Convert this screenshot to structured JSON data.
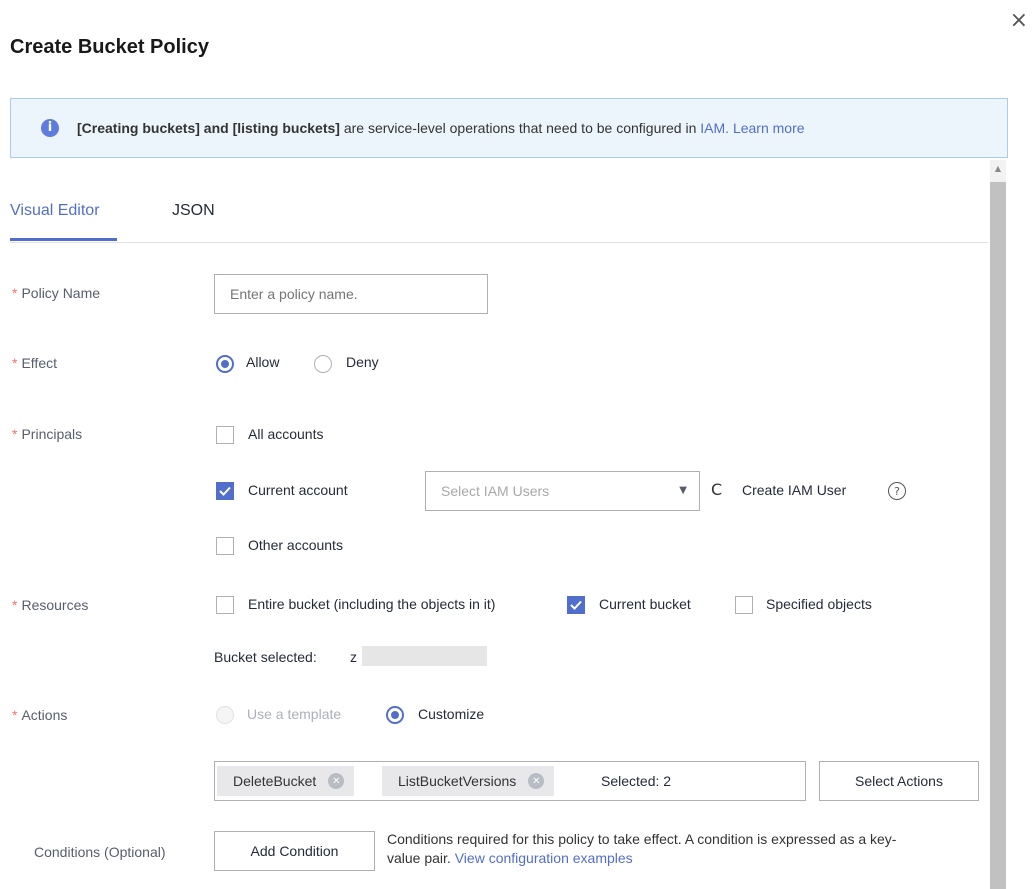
{
  "dialog": {
    "title": "Create Bucket Policy",
    "close_icon": "×"
  },
  "banner": {
    "icon": "i",
    "bold_text": "[Creating buckets] and [listing buckets]",
    "text": " are service-level operations that need to be configured in ",
    "iam_link": "IAM.",
    "learn_more": " Learn more"
  },
  "tabs": [
    {
      "label": "Visual Editor",
      "active": true
    },
    {
      "label": "JSON",
      "active": false
    }
  ],
  "form": {
    "policy_name": {
      "label": "Policy Name",
      "required_mark": "*",
      "placeholder": "Enter a policy name."
    },
    "effect": {
      "label": "Effect",
      "required_mark": "*",
      "options": [
        "Allow",
        "Deny"
      ],
      "selected": "Allow"
    },
    "principals": {
      "label": "Principals",
      "required_mark": "*",
      "all_accounts": {
        "label": "All accounts",
        "checked": false
      },
      "current_account": {
        "label": "Current account",
        "checked": true
      },
      "iam_select_placeholder": "Select IAM Users",
      "dropdown_icon": "▼",
      "refresh_icon": "C",
      "create_iam_user": "Create IAM User",
      "help_icon": "?",
      "other_accounts": {
        "label": "Other accounts",
        "checked": false
      }
    },
    "resources": {
      "label": "Resources",
      "required_mark": "*",
      "entire_bucket": {
        "label": "Entire bucket (including the objects in it)",
        "checked": false
      },
      "current_bucket": {
        "label": "Current bucket",
        "checked": true
      },
      "specified_objects": {
        "label": "Specified objects",
        "checked": false
      },
      "bucket_selected_label": "Bucket selected:",
      "bucket_selected_value": "z"
    },
    "actions": {
      "label": "Actions",
      "required_mark": "*",
      "use_template": "Use a template",
      "customize": "Customize",
      "selected_mode": "Customize",
      "tags": [
        "DeleteBucket",
        "ListBucketVersions"
      ],
      "tag_remove_icon": "✕",
      "selected_count_text": "Selected: 2",
      "select_actions_button": "Select Actions"
    },
    "conditions": {
      "label": "Conditions (Optional)",
      "add_condition_button": "Add Condition",
      "description": "Conditions required for this policy to take effect. A condition is expressed as a key-",
      "description_line2": "value pair.",
      "examples_link": "View configuration examples"
    }
  },
  "scrollbar": {
    "up_arrow": "▲"
  }
}
